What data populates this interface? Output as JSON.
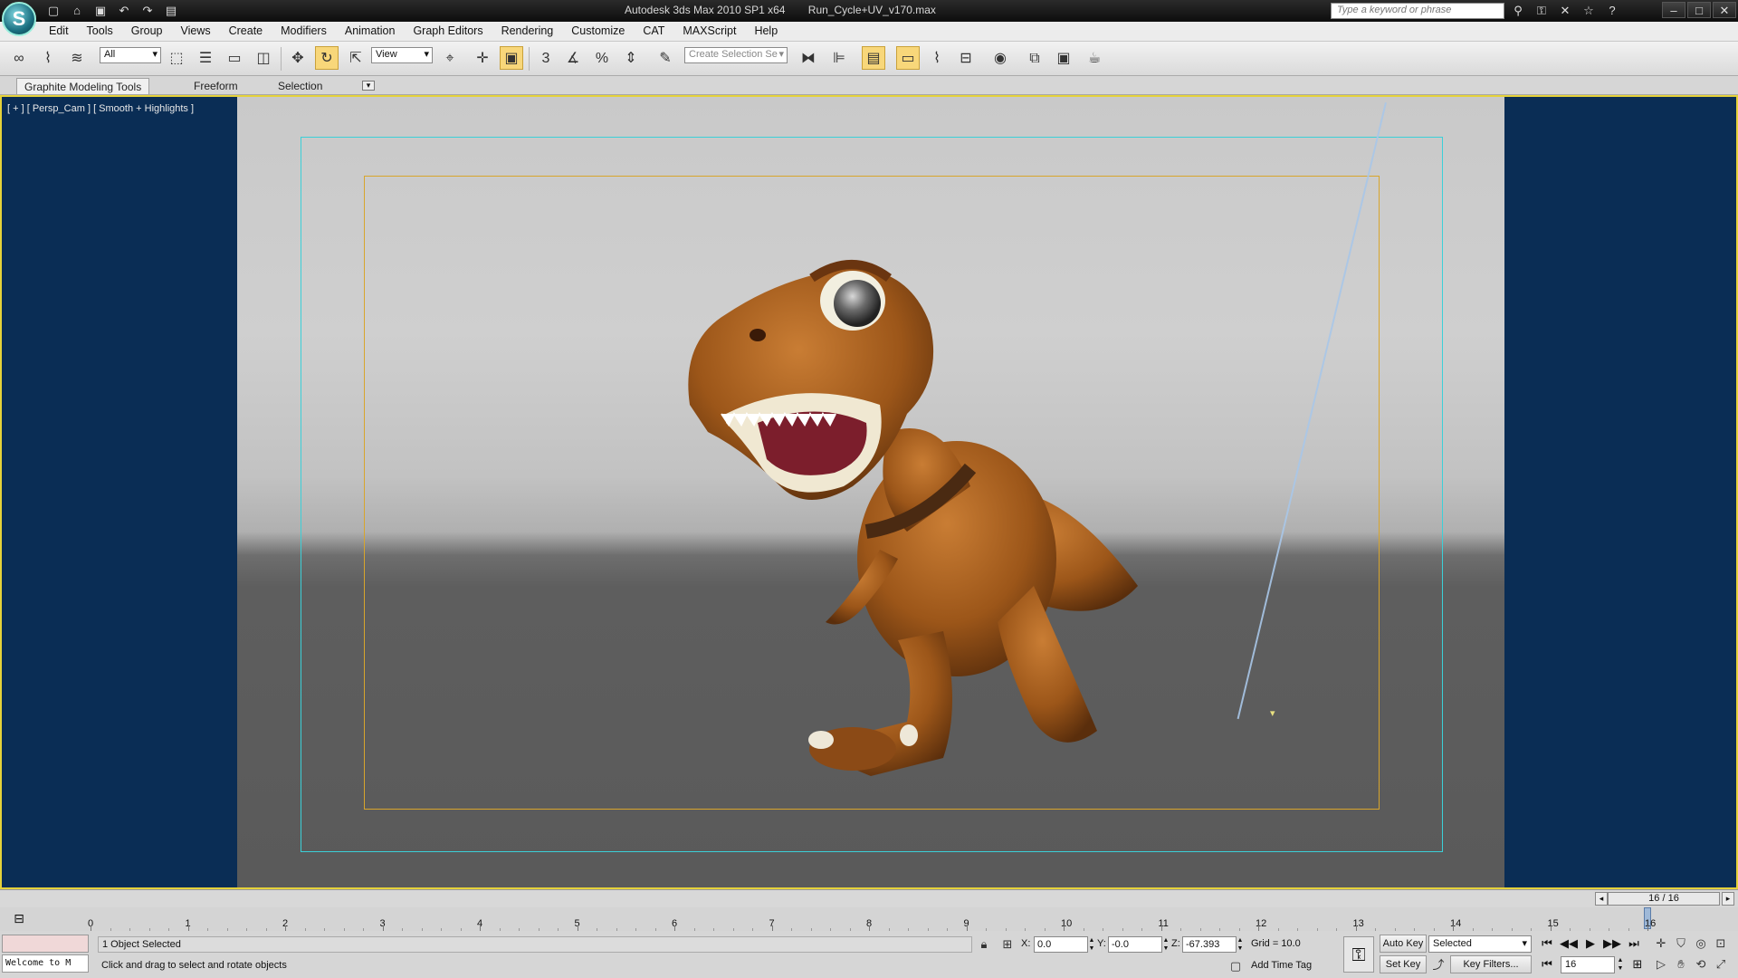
{
  "title_bar": {
    "app_title": "Autodesk 3ds Max  2010 SP1 x64",
    "file_name": "Run_Cycle+UV_v170.max",
    "search_placeholder": "Type a keyword or phrase"
  },
  "menu": [
    "Edit",
    "Tools",
    "Group",
    "Views",
    "Create",
    "Modifiers",
    "Animation",
    "Graph Editors",
    "Rendering",
    "Customize",
    "CAT",
    "MAXScript",
    "Help"
  ],
  "toolbar": {
    "selection_filter": "All",
    "reference_coord": "View",
    "snap_label": "3",
    "named_selection_placeholder": "Create Selection Se"
  },
  "ribbon": {
    "tabs": [
      "Graphite Modeling Tools",
      "Freeform",
      "Selection"
    ]
  },
  "viewport": {
    "label": "[ + ] [ Persp_Cam ] [ Smooth + Highlights ]"
  },
  "timeline": {
    "slider_label": "16 / 16",
    "ticks": [
      "0",
      "1",
      "2",
      "3",
      "4",
      "5",
      "6",
      "7",
      "8",
      "9",
      "10",
      "11",
      "12",
      "13",
      "14",
      "15",
      "16"
    ],
    "current_frame": 16
  },
  "status": {
    "maxscript_text": "Welcome to M",
    "selection_text": "1 Object Selected",
    "prompt_text": "Click and drag to select and rotate objects",
    "x_label": "X:",
    "x_value": "0.0",
    "y_label": "Y:",
    "y_value": "-0.0",
    "z_label": "Z:",
    "z_value": "-67.393",
    "grid_text": "Grid = 10.0",
    "add_time_tag": "Add Time Tag",
    "auto_key": "Auto Key",
    "set_key": "Set Key",
    "key_mode": "Selected",
    "key_filters": "Key Filters...",
    "frame_value": "16"
  },
  "colors": {
    "viewport_bg": "#0a2d55",
    "active_border": "#e5d23a",
    "safe_frame_outer": "#3bd0d8",
    "safe_frame_inner": "#d8a52c",
    "dino_body": "#a85a1c"
  }
}
